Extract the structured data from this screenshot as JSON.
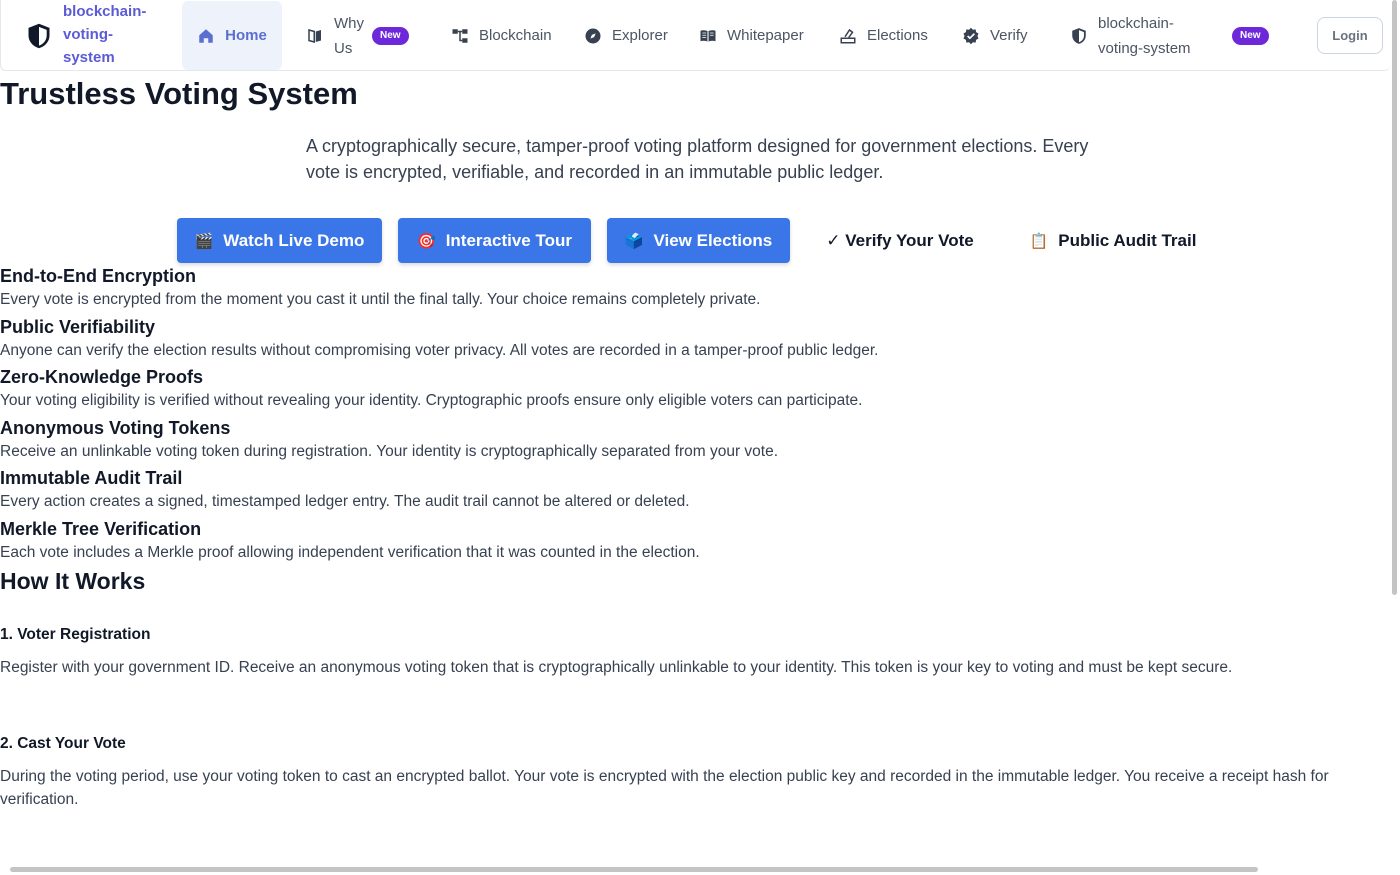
{
  "nav": {
    "brand": "blockchain-voting-system",
    "items": [
      {
        "label": "Home",
        "icon": "home-icon"
      },
      {
        "label": "Why Us",
        "icon": "book-icon",
        "badge": "New"
      },
      {
        "label": "Blockchain",
        "icon": "blockchain-icon"
      },
      {
        "label": "Explorer",
        "icon": "compass-icon"
      },
      {
        "label": "Whitepaper",
        "icon": "open-book-icon"
      },
      {
        "label": "Elections",
        "icon": "ballot-box-icon"
      },
      {
        "label": "Verify",
        "icon": "verified-badge-icon"
      },
      {
        "label": "blockchain-voting-system",
        "icon": "shield-icon",
        "badge": "New"
      }
    ],
    "login": "Login"
  },
  "hero": {
    "title": "Trustless Voting System",
    "description": "A cryptographically secure, tamper-proof voting platform designed for government elections. Every vote is encrypted, verifiable, and recorded in an immutable public ledger."
  },
  "actions": [
    {
      "icon": "🎬",
      "label": "Watch Live Demo"
    },
    {
      "icon": "🎯",
      "label": "Interactive Tour"
    },
    {
      "icon": "🗳️",
      "label": "View Elections"
    },
    {
      "icon": "",
      "label": "✓ Verify Your Vote"
    },
    {
      "icon": "📋",
      "label": "Public Audit Trail"
    }
  ],
  "features": [
    {
      "title": "End-to-End Encryption",
      "text": "Every vote is encrypted from the moment you cast it until the final tally. Your choice remains completely private."
    },
    {
      "title": "Public Verifiability",
      "text": "Anyone can verify the election results without compromising voter privacy. All votes are recorded in a tamper-proof public ledger."
    },
    {
      "title": "Zero-Knowledge Proofs",
      "text": "Your voting eligibility is verified without revealing your identity. Cryptographic proofs ensure only eligible voters can participate."
    },
    {
      "title": "Anonymous Voting Tokens",
      "text": "Receive an unlinkable voting token during registration. Your identity is cryptographically separated from your vote."
    },
    {
      "title": "Immutable Audit Trail",
      "text": "Every action creates a signed, timestamped ledger entry. The audit trail cannot be altered or deleted."
    },
    {
      "title": "Merkle Tree Verification",
      "text": "Each vote includes a Merkle proof allowing independent verification that it was counted in the election."
    }
  ],
  "how": {
    "title": "How It Works",
    "steps": [
      {
        "title": "1. Voter Registration",
        "text": "Register with your government ID. Receive an anonymous voting token that is cryptographically unlinkable to your identity. This token is your key to voting and must be kept secure."
      },
      {
        "title": "2. Cast Your Vote",
        "text": "During the voting period, use your voting token to cast an encrypted ballot. Your vote is encrypted with the election public key and recorded in the immutable ledger. You receive a receipt hash for verification."
      }
    ]
  }
}
